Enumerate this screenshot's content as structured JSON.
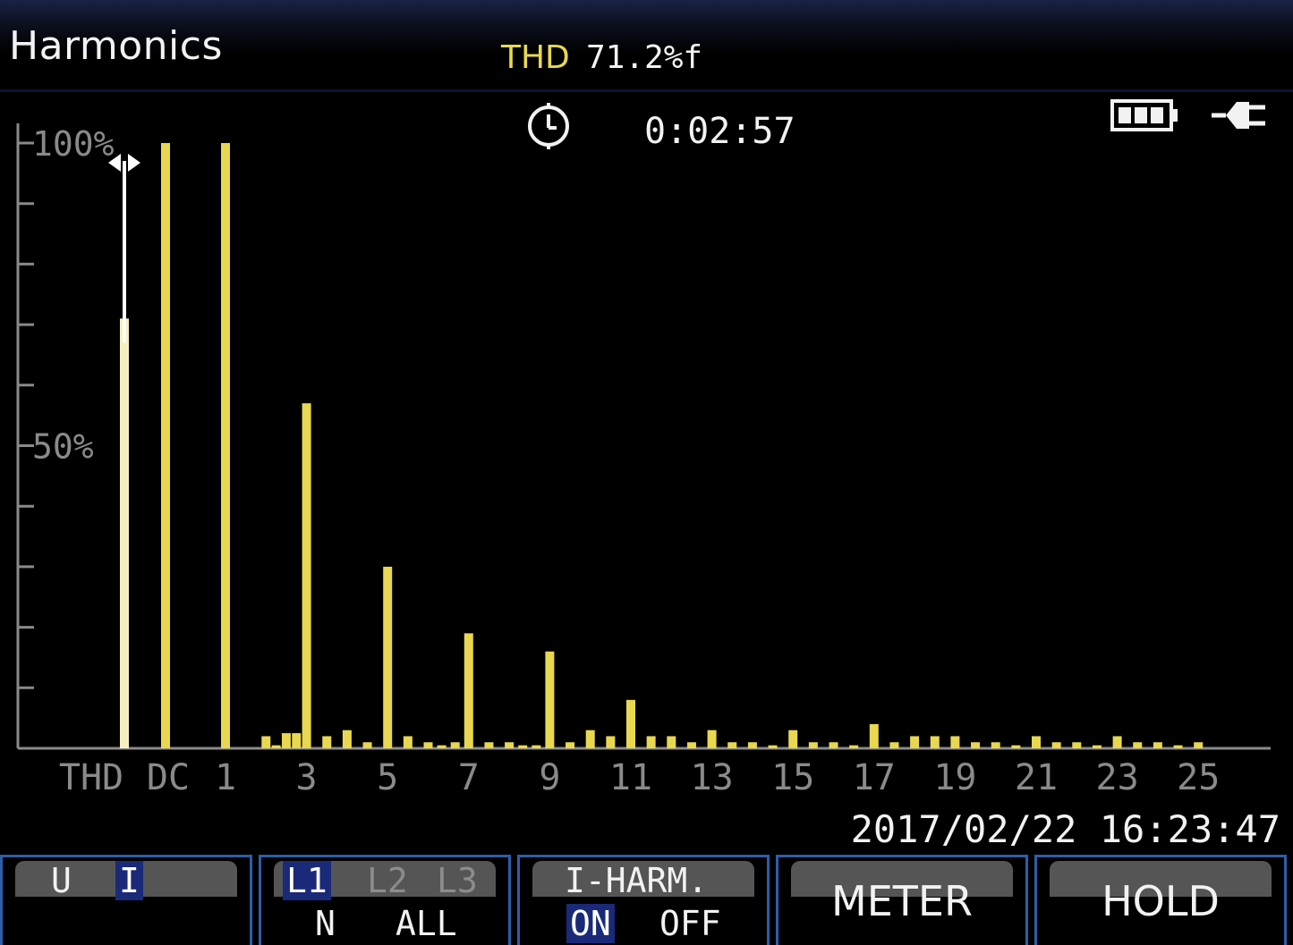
{
  "header": {
    "title": "Harmonics",
    "thd_label": "THD",
    "thd_value": "71.2%f"
  },
  "status": {
    "timer_icon": "timer-icon",
    "timer": "0:02:57",
    "battery_icon": "battery-icon",
    "plug_icon": "plug-icon"
  },
  "chart_data": {
    "type": "bar",
    "title": "",
    "ylabel": "",
    "xlabel": "",
    "ylim": [
      0,
      100
    ],
    "y_tick_labels": [
      "50%",
      "100%"
    ],
    "x_tick_labels": [
      "THD",
      "DC",
      "1",
      "3",
      "5",
      "7",
      "9",
      "11",
      "13",
      "15",
      "17",
      "19",
      "21",
      "23",
      "25"
    ],
    "grid": false,
    "bar_color": "#e8d850",
    "thd_cursor_color": "#ffffff",
    "categories": [
      "THD",
      "DC",
      "1",
      "2",
      "3",
      "4",
      "5",
      "6",
      "7",
      "8",
      "9",
      "10",
      "11",
      "12",
      "13",
      "14",
      "15",
      "16",
      "17",
      "18",
      "19",
      "20",
      "21",
      "22",
      "23",
      "24",
      "25"
    ],
    "values": [
      71,
      100,
      100,
      2,
      57,
      3,
      30,
      1,
      19,
      1,
      16,
      3,
      8,
      2,
      3,
      1,
      3,
      1,
      4,
      2,
      2,
      1,
      2,
      1,
      2,
      1,
      1
    ],
    "sub_values": [
      [],
      [],
      [],
      [
        0.5,
        2.5,
        2.5
      ],
      [
        2
      ],
      [
        1
      ],
      [
        2
      ],
      [
        0.5,
        1
      ],
      [
        1
      ],
      [
        0.5,
        0.5
      ],
      [
        1
      ],
      [
        2
      ],
      [
        2
      ],
      [
        1
      ],
      [
        1
      ],
      [
        0.5
      ],
      [
        1
      ],
      [
        0.5
      ],
      [
        1
      ],
      [
        2
      ],
      [
        1
      ],
      [
        0.5
      ],
      [
        1
      ],
      [
        0.5
      ],
      [
        1
      ],
      [
        0.5
      ],
      []
    ]
  },
  "timestamp": "2017/02/22 16:23:47",
  "softkeys": {
    "k1": {
      "opt_u": "U",
      "opt_i": "I"
    },
    "k2": {
      "l1": "L1",
      "l2": "L2",
      "l3": "L3",
      "n": "N",
      "all": "ALL"
    },
    "k3": {
      "label": "I-HARM.",
      "on": "ON",
      "off": "OFF"
    },
    "k4": {
      "label": "METER"
    },
    "k5": {
      "label": "HOLD"
    }
  }
}
